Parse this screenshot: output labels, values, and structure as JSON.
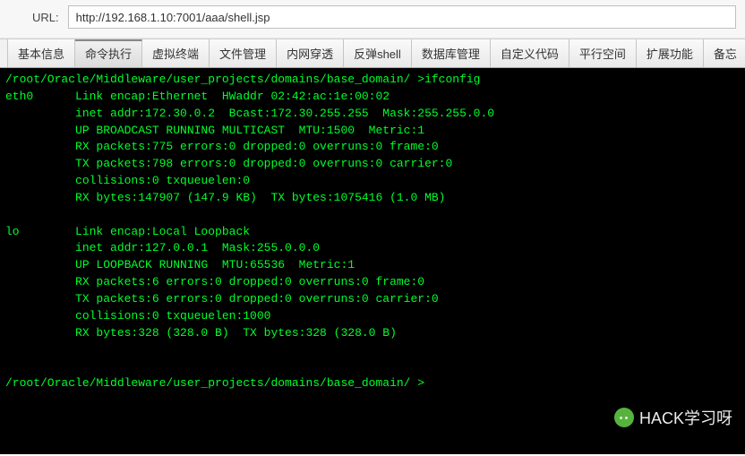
{
  "url_bar": {
    "label": "URL:",
    "value": "http://192.168.1.10:7001/aaa/shell.jsp"
  },
  "tabs": [
    {
      "id": "basic",
      "label": "基本信息",
      "active": false
    },
    {
      "id": "cmd",
      "label": "命令执行",
      "active": true
    },
    {
      "id": "vterm",
      "label": "虚拟终端",
      "active": false
    },
    {
      "id": "files",
      "label": "文件管理",
      "active": false
    },
    {
      "id": "intranet",
      "label": "内网穿透",
      "active": false
    },
    {
      "id": "revshell",
      "label": "反弹shell",
      "active": false
    },
    {
      "id": "db",
      "label": "数据库管理",
      "active": false
    },
    {
      "id": "custom",
      "label": "自定义代码",
      "active": false
    },
    {
      "id": "parallel",
      "label": "平行空间",
      "active": false
    },
    {
      "id": "ext",
      "label": "扩展功能",
      "active": false
    },
    {
      "id": "notes",
      "label": "备忘",
      "active": false
    }
  ],
  "terminal": {
    "lines": [
      "/root/Oracle/Middleware/user_projects/domains/base_domain/ >ifconfig",
      "eth0      Link encap:Ethernet  HWaddr 02:42:ac:1e:00:02",
      "          inet addr:172.30.0.2  Bcast:172.30.255.255  Mask:255.255.0.0",
      "          UP BROADCAST RUNNING MULTICAST  MTU:1500  Metric:1",
      "          RX packets:775 errors:0 dropped:0 overruns:0 frame:0",
      "          TX packets:798 errors:0 dropped:0 overruns:0 carrier:0",
      "          collisions:0 txqueuelen:0",
      "          RX bytes:147907 (147.9 KB)  TX bytes:1075416 (1.0 MB)",
      "",
      "lo        Link encap:Local Loopback",
      "          inet addr:127.0.0.1  Mask:255.0.0.0",
      "          UP LOOPBACK RUNNING  MTU:65536  Metric:1",
      "          RX packets:6 errors:0 dropped:0 overruns:0 frame:0",
      "          TX packets:6 errors:0 dropped:0 overruns:0 carrier:0",
      "          collisions:0 txqueuelen:1000",
      "          RX bytes:328 (328.0 B)  TX bytes:328 (328.0 B)",
      "",
      "",
      "/root/Oracle/Middleware/user_projects/domains/base_domain/ >"
    ]
  },
  "watermark": {
    "text": "HACK学习呀"
  }
}
